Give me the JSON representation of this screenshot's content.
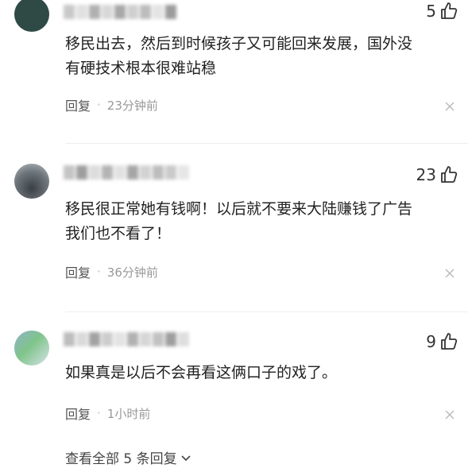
{
  "comments": [
    {
      "likes": "5",
      "text_line1": "移民出去，然后到时候孩子又可能回来发展，国外没",
      "text_line2": "有硬技术根本很难站稳",
      "reply_label": "回复",
      "time": "23分钟前"
    },
    {
      "likes": "23",
      "text_line1": "移民很正常她有钱啊！以后就不要来大陆赚钱了广告",
      "text_line2": "我们也不看了！",
      "reply_label": "回复",
      "time": "36分钟前"
    },
    {
      "likes": "9",
      "text_line1": "如果真是以后不会再看这俩口子的戏了。",
      "reply_label": "回复",
      "time": "1小时前"
    }
  ],
  "view_all_label": "查看全部 5 条回复",
  "icons": {
    "like": "thumbs-up-icon",
    "close": "close-icon",
    "expand": "chevron-down-icon"
  },
  "colors": {
    "text": "#222222",
    "meta": "#999999",
    "icon": "#333333"
  }
}
